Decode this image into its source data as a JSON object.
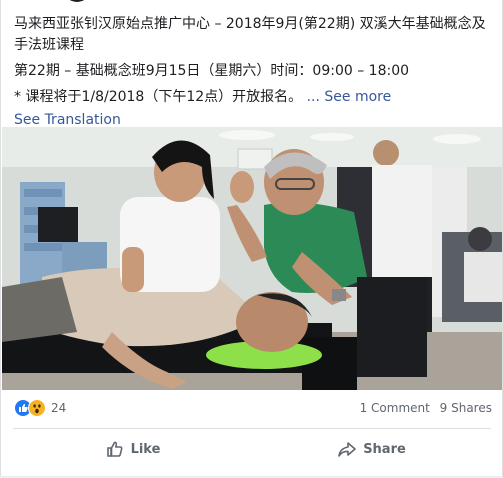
{
  "post": {
    "line1": "马来西亚张钊汉原始点推广中心 – 2018年9月(第22期) 双溪大年基础概念及手法班课程",
    "line2": "第22期 – 基础概念班9月15日（星期六）时间：09:00 – 18:00",
    "line3": "* 课程将于1/8/2018（下午12点）开放报名。",
    "see_more": "... See more",
    "see_translation": "See Translation"
  },
  "reactions": {
    "icons": [
      "like-icon",
      "wow-icon"
    ],
    "count": "24",
    "comments": "1 Comment",
    "shares": "9 Shares"
  },
  "actions": {
    "like": "Like",
    "share": "Share"
  },
  "colors": {
    "link": "#365899",
    "like_blue": "#2078f4",
    "wow_yellow": "#f7b125",
    "muted": "#606770"
  }
}
